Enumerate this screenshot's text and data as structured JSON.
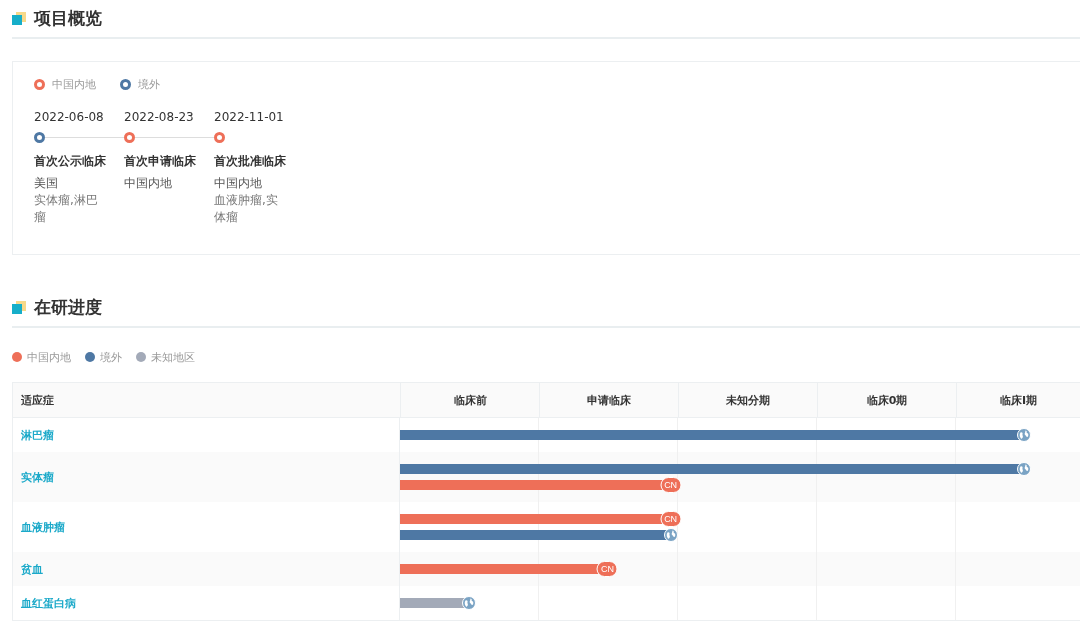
{
  "overview": {
    "title": "项目概览",
    "legend": [
      {
        "label": "中国内地",
        "color": "#ee6f58"
      },
      {
        "label": "境外",
        "color": "#4e78a4"
      }
    ],
    "events": [
      {
        "date": "2022-06-08",
        "title": "首次公示临床",
        "region": "美国",
        "indications": "实体瘤,淋巴瘤",
        "color": "#4e78a4"
      },
      {
        "date": "2022-08-23",
        "title": "首次申请临床",
        "region": "中国内地",
        "color": "#ee6f58"
      },
      {
        "date": "2022-11-01",
        "title": "首次批准临床",
        "region": "中国内地",
        "indications": "血液肿瘤,实体瘤",
        "color": "#ee6f58"
      }
    ]
  },
  "progress": {
    "title": "在研进度",
    "legend": [
      {
        "label": "中国内地",
        "color": "#ee6f58"
      },
      {
        "label": "境外",
        "color": "#4e78a4"
      },
      {
        "label": "未知地区",
        "color": "#a3aab8"
      }
    ],
    "columns": [
      "适应症",
      "临床前",
      "申请临床",
      "未知分期",
      "临床0期",
      "临床I期"
    ],
    "rows": [
      {
        "indication": "淋巴瘤",
        "bars": [
          {
            "color": "#4e78a4",
            "level": 0.918,
            "kind": "globe"
          }
        ]
      },
      {
        "indication": "实体瘤",
        "bars": [
          {
            "color": "#4e78a4",
            "level": 0.918,
            "kind": "globe"
          },
          {
            "color": "#ee6f58",
            "level": 0.398,
            "kind": "badge",
            "badge": "CN"
          }
        ]
      },
      {
        "indication": "血液肿瘤",
        "bars": [
          {
            "color": "#ee6f58",
            "level": 0.398,
            "kind": "badge",
            "badge": "CN"
          },
          {
            "color": "#4e78a4",
            "level": 0.398,
            "kind": "globe"
          }
        ]
      },
      {
        "indication": "贫血",
        "bars": [
          {
            "color": "#ee6f58",
            "level": 0.305,
            "kind": "badge",
            "badge": "CN"
          }
        ]
      },
      {
        "indication": "血红蛋白病",
        "bars": [
          {
            "color": "#a3aab8",
            "level": 0.101,
            "kind": "globe"
          }
        ]
      }
    ]
  }
}
